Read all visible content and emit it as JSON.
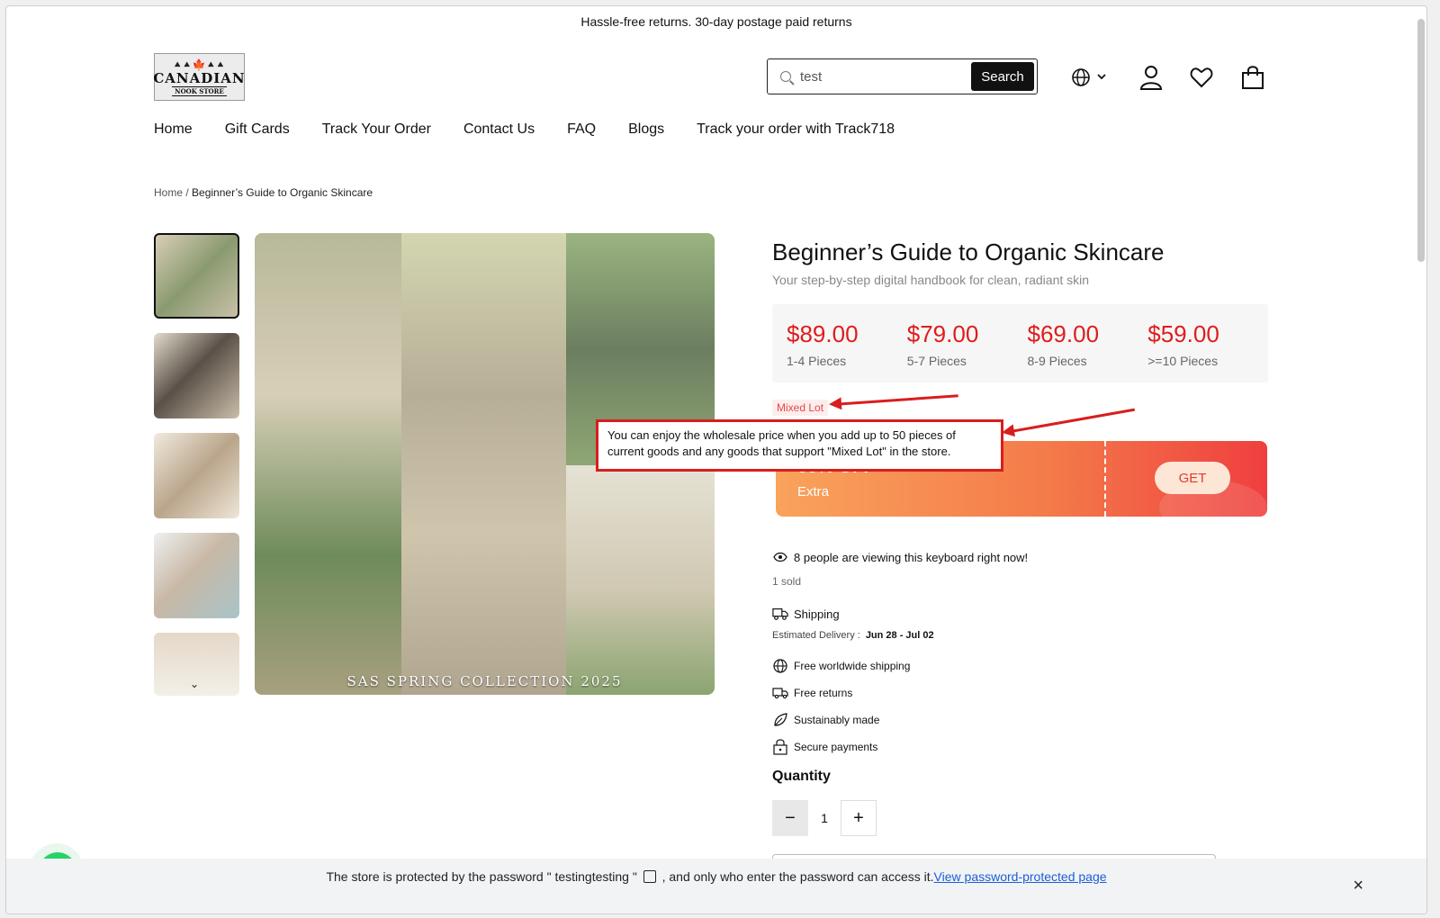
{
  "announcement": "Hassle-free returns. 30-day postage paid returns",
  "logo": {
    "trees": "⯅⯅🍁⯅⯅",
    "line1": "CANADIAN",
    "line2": "NOOK STORE"
  },
  "search": {
    "value": "test",
    "button_label": "Search"
  },
  "nav": [
    "Home",
    "Gift Cards",
    "Track Your Order",
    "Contact Us",
    "FAQ",
    "Blogs",
    "Track your order with Track718"
  ],
  "breadcrumb": {
    "home": "Home",
    "separator": " / ",
    "current": "Beginner’s Guide to Organic Skincare"
  },
  "gallery": {
    "caption": "SAS   SPRING COLLECTION 2025",
    "more_icon": "chevron-down-icon"
  },
  "product": {
    "title": "Beginner’s Guide to Organic Skincare",
    "subtitle": "Your step-by-step digital handbook for clean, radiant skin",
    "tiers": [
      {
        "price": "$89.00",
        "qty": "1-4 Pieces"
      },
      {
        "price": "$79.00",
        "qty": "5-7 Pieces"
      },
      {
        "price": "$69.00",
        "qty": "8-9 Pieces"
      },
      {
        "price": "$59.00",
        "qty": ">=10 Pieces"
      }
    ],
    "mixed_lot": "Mixed Lot",
    "tooltip": "You can enjoy the wholesale price when you add up to 50 pieces of current goods and any goods that support \"Mixed Lot\" in the store.",
    "coupon": {
      "off": "30% OFF",
      "extra": "Extra",
      "button": "GET"
    },
    "viewing": "8 people are viewing this keyboard right now!",
    "sold": "1 sold",
    "shipping_label": "Shipping",
    "delivery_label": "Estimated Delivery :",
    "delivery_value": "Jun 28 - Jul 02",
    "features": [
      "Free worldwide shipping",
      "Free returns",
      "Sustainably made",
      "Secure payments"
    ],
    "quantity_label": "Quantity",
    "quantity_value": "1"
  },
  "notice": {
    "text_before": "The store is protected by the password \" testingtesting \"",
    "text_after": ", and only who enter the password can access it.",
    "link": "View password-protected page",
    "close": "×"
  },
  "colors": {
    "price": "#e01c1c",
    "coupon_start": "#f9a35c",
    "coupon_end": "#ef3f3f",
    "annotation": "#d81e1e",
    "link": "#1a5fd6"
  }
}
